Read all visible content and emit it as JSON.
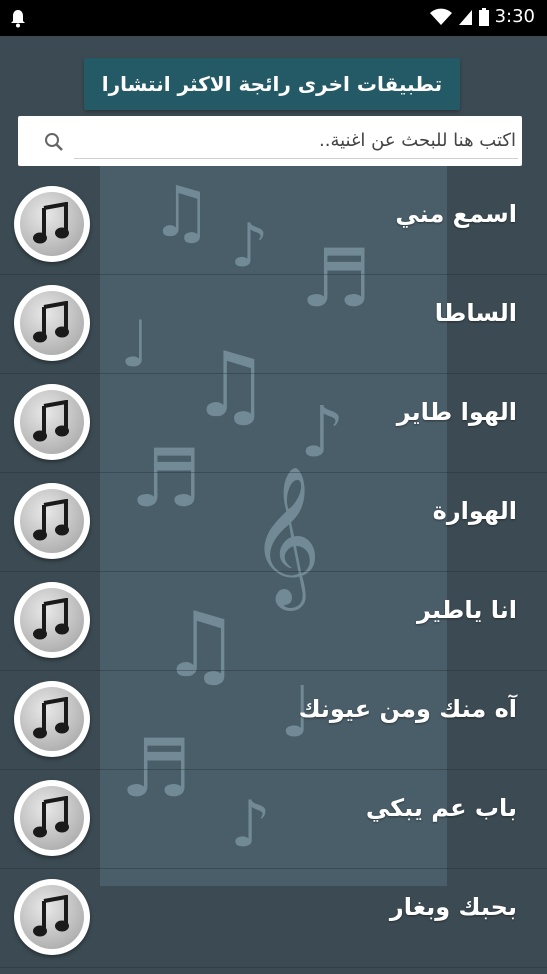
{
  "status_bar": {
    "time": "3:30"
  },
  "banner": {
    "label": "تطبيقات اخرى رائجة الاكثر انتشارا"
  },
  "search": {
    "placeholder": "اكتب هنا للبحث عن اغنية.."
  },
  "songs": [
    {
      "title": "اسمع مني"
    },
    {
      "title": "الساطا"
    },
    {
      "title": "الهوا طاير"
    },
    {
      "title": "الهوارة"
    },
    {
      "title": "انا ياطير"
    },
    {
      "title": "آه منك ومن عيونك"
    },
    {
      "title": "باب عم يبكي"
    },
    {
      "title": "بحبك وبغار"
    }
  ]
}
